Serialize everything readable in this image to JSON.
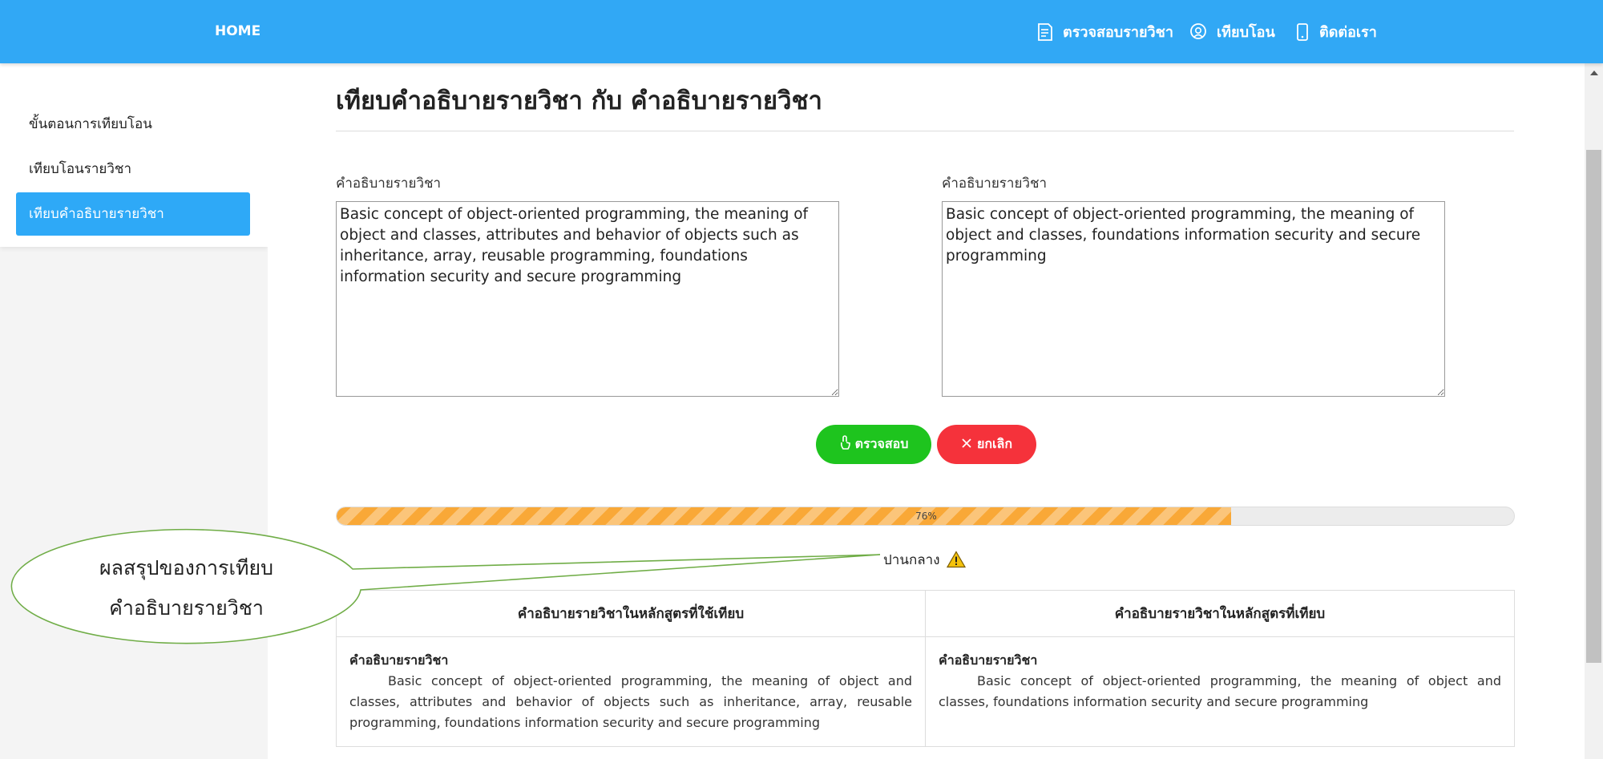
{
  "header": {
    "home_label": "HOME",
    "nav": [
      {
        "label": "ตรวจสอบรายวิชา",
        "icon": "document-icon"
      },
      {
        "label": "เทียบโอน",
        "icon": "location-pin-icon"
      },
      {
        "label": "ติดต่อเรา",
        "icon": "mobile-phone-icon"
      }
    ]
  },
  "sidebar": {
    "items": [
      {
        "label": "ขั้นตอนการเทียบโอน",
        "active": false
      },
      {
        "label": "เทียบโอนรายวิชา",
        "active": false
      },
      {
        "label": "เทียบคำอธิบายรายวิชา",
        "active": true
      }
    ]
  },
  "main": {
    "title": "เทียบคำอธิบายรายวิชา กับ คำอธิบายรายวิชา",
    "left_field": {
      "label": "คำอธิบายรายวิชา",
      "value": "Basic concept of object-oriented programming, the meaning of object and classes, attributes and behavior of objects such as inheritance, array, reusable programming, foundations information security and secure programming"
    },
    "right_field": {
      "label": "คำอธิบายรายวิชา",
      "value": "Basic concept of object-oriented programming, the meaning of object and classes, foundations information security and secure programming"
    },
    "check_button": "ตรวจสอบ",
    "cancel_button": "ยกเลิก",
    "progress": {
      "label": "76%",
      "value": 76
    },
    "result_label": "ปานกลาง",
    "table": {
      "headers": [
        "คำอธิบายรายวิชาในหลักสูตรที่ใช้เทียบ",
        "คำอธิบายรายวิชาในหลักสูตรที่เทียบ"
      ],
      "rows": [
        {
          "left_title": "คำอธิบายรายวิชา",
          "left_text": "Basic concept of object-oriented programming, the meaning of object and classes, attributes and behavior of objects such as inheritance, array, reusable programming, foundations information security and secure programming",
          "right_title": "คำอธิบายรายวิชา",
          "right_text": "Basic concept of object-oriented programming, the meaning of object and classes, foundations information security and secure programming"
        }
      ]
    }
  },
  "annotation": {
    "line1": "ผลสรุปของการเทียบ",
    "line2": "คำอธิบายรายวิชา",
    "stroke_color": "#70ad47"
  },
  "colors": {
    "header_bg": "#31a8f5",
    "active_item": "#2ea9f7",
    "check_button": "#1ec41e",
    "cancel_button": "#f5323b",
    "progress_fill": "#f9a837",
    "warning": "#f4c20d"
  }
}
